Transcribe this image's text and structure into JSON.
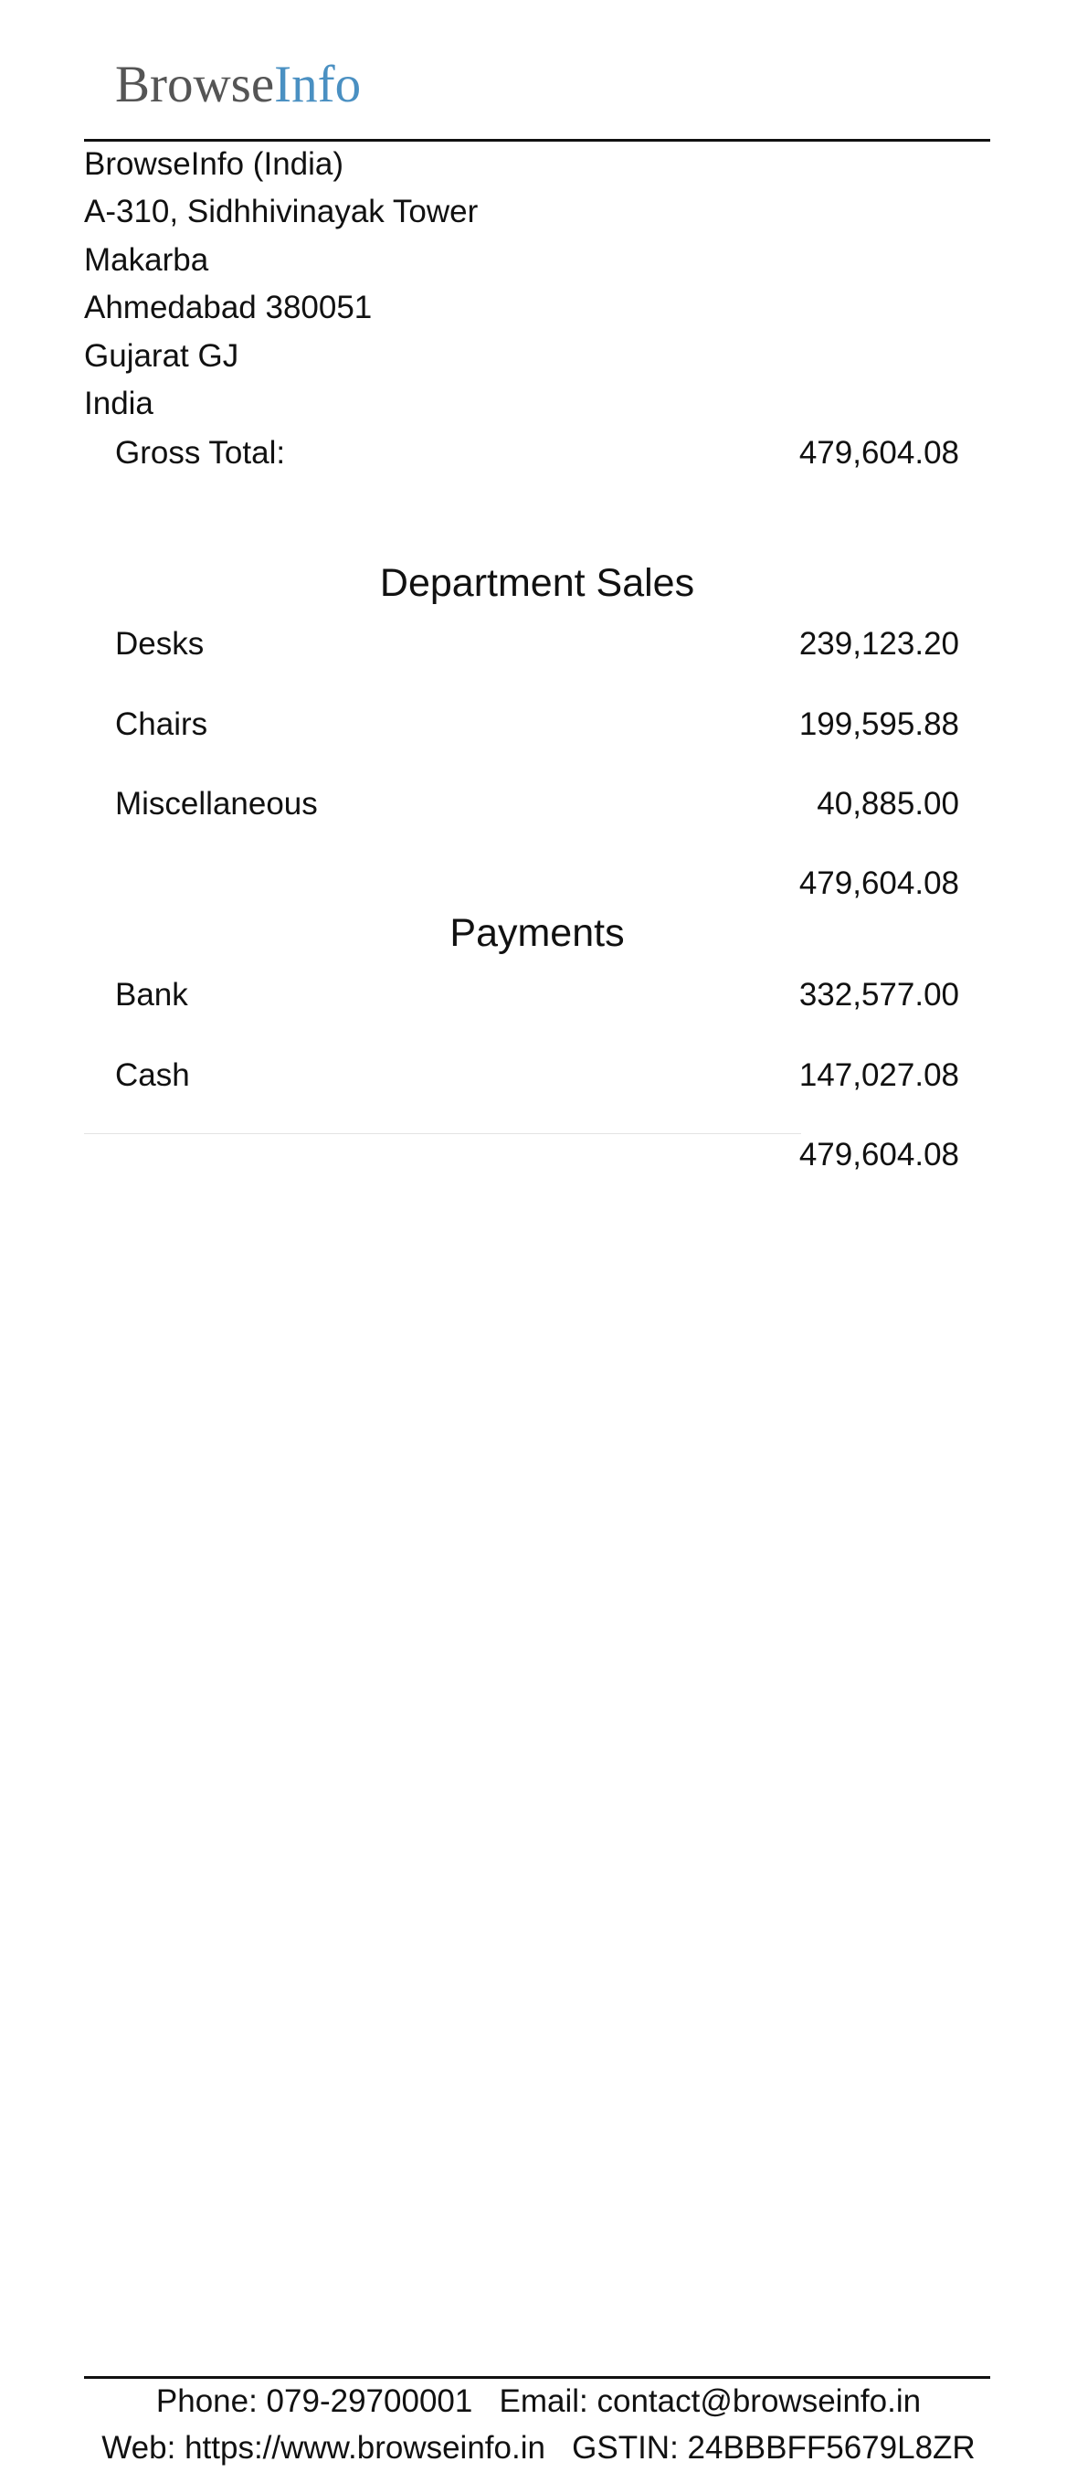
{
  "logo": {
    "part_1": "Browse",
    "part_2": "Info",
    "colors": {
      "part_1": "#555555",
      "part_2": "#4a90c2"
    }
  },
  "company": {
    "name": "BrowseInfo (India)",
    "street": "A-310, Sidhhivinayak Tower",
    "area": "Makarba",
    "city_zip": "Ahmedabad 380051",
    "state": "Gujarat GJ",
    "country": "India"
  },
  "gross": {
    "label": "Gross Total:",
    "value": "479,604.08"
  },
  "department_sales": {
    "title": "Department Sales",
    "rows": [
      {
        "label": "Desks",
        "value": "239,123.20"
      },
      {
        "label": "Chairs",
        "value": "199,595.88"
      },
      {
        "label": "Miscellaneous",
        "value": "40,885.00"
      }
    ],
    "total": "479,604.08"
  },
  "payments": {
    "title": "Payments",
    "rows": [
      {
        "label": "Bank",
        "value": "332,577.00"
      },
      {
        "label": "Cash",
        "value": "147,027.08"
      }
    ],
    "total": "479,604.08"
  },
  "footer": {
    "line_1": "Phone: 079-29700001   Email: contact@browseinfo.in",
    "line_2": "Web: https://www.browseinfo.in   GSTIN: 24BBBFF5679L8ZR"
  }
}
